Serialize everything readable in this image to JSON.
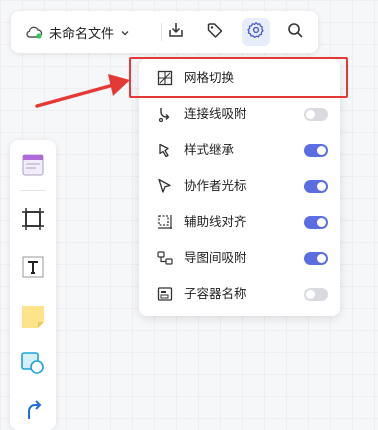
{
  "toolbar": {
    "file_title": "未命名文件",
    "cloud_icon": "cloud-sync-icon",
    "dropdown_icon": "chevron-down-icon",
    "buttons": [
      {
        "name": "download-icon"
      },
      {
        "name": "tag-icon"
      },
      {
        "name": "gear-icon",
        "active": true
      },
      {
        "name": "search-icon"
      }
    ]
  },
  "settings_menu": {
    "items": [
      {
        "label": "网格切换",
        "icon": "grid-icon",
        "has_toggle": false
      },
      {
        "label": "连接线吸附",
        "icon": "connector-snap-icon",
        "toggle_on": false
      },
      {
        "label": "样式继承",
        "icon": "style-inherit-icon",
        "toggle_on": true
      },
      {
        "label": "协作者光标",
        "icon": "collaborator-cursor-icon",
        "toggle_on": true
      },
      {
        "label": "辅助线对齐",
        "icon": "guide-align-icon",
        "toggle_on": true
      },
      {
        "label": "导图间吸附",
        "icon": "mindmap-snap-icon",
        "toggle_on": true
      },
      {
        "label": "子容器名称",
        "icon": "sub-container-icon",
        "toggle_on": false
      }
    ]
  },
  "left_panel": {
    "tools": [
      "template-icon",
      "frame-icon",
      "text-icon",
      "sticky-note-icon",
      "shape-icon",
      "connector-icon"
    ]
  },
  "colors": {
    "accent": "#5b6ee1",
    "annotation_red": "#e53935",
    "toggle_off": "#d9dbe0"
  }
}
